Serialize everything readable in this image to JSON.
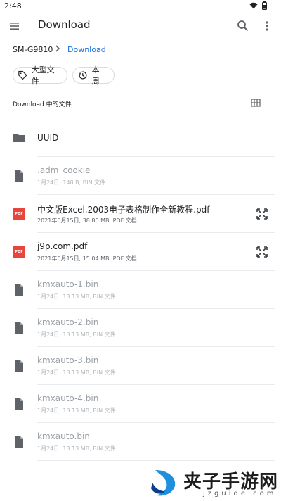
{
  "status_bar": {
    "time": "2:48"
  },
  "app_bar": {
    "title": "Download"
  },
  "breadcrumb": {
    "root": "SM-G9810",
    "current": "Download"
  },
  "chips": [
    {
      "label": "大型文件",
      "icon": "tag-icon"
    },
    {
      "label": "本周",
      "icon": "history-icon"
    }
  ],
  "section": {
    "label": "Download 中的文件"
  },
  "files": [
    {
      "name": "UUID",
      "meta": "",
      "type": "folder",
      "dimmed": false,
      "expandable": false
    },
    {
      "name": ".adm_cookie",
      "meta": "1月24日, 148 B, BIN 文件",
      "type": "file",
      "dimmed": true,
      "expandable": false
    },
    {
      "name": "中文版Excel.2003电子表格制作全新教程.pdf",
      "meta": "2021年6月15日, 38.80 MB, PDF 文档",
      "type": "pdf",
      "dimmed": false,
      "expandable": true
    },
    {
      "name": "j9p.com.pdf",
      "meta": "2021年6月15日, 15.04 MB, PDF 文档",
      "type": "pdf",
      "dimmed": false,
      "expandable": true
    },
    {
      "name": "kmxauto-1.bin",
      "meta": "1月24日, 13.13 MB, BIN 文件",
      "type": "file",
      "dimmed": true,
      "expandable": false
    },
    {
      "name": "kmxauto-2.bin",
      "meta": "1月24日, 13.13 MB, BIN 文件",
      "type": "file",
      "dimmed": true,
      "expandable": false
    },
    {
      "name": "kmxauto-3.bin",
      "meta": "1月24日, 13.13 MB, BIN 文件",
      "type": "file",
      "dimmed": true,
      "expandable": false
    },
    {
      "name": "kmxauto-4.bin",
      "meta": "1月24日, 13.13 MB, BIN 文件",
      "type": "file",
      "dimmed": true,
      "expandable": false
    },
    {
      "name": "kmxauto.bin",
      "meta": "1月24日, 13.13 MB, BIN 文件",
      "type": "file",
      "dimmed": true,
      "expandable": false
    }
  ],
  "watermark": {
    "text_cn": "夹子手游网",
    "text_en": "jzguide.com"
  },
  "colors": {
    "accent": "#1a73e8",
    "pdf_red": "#e8453c",
    "icon_grey": "#5f6368",
    "divider": "#e8eaed"
  }
}
